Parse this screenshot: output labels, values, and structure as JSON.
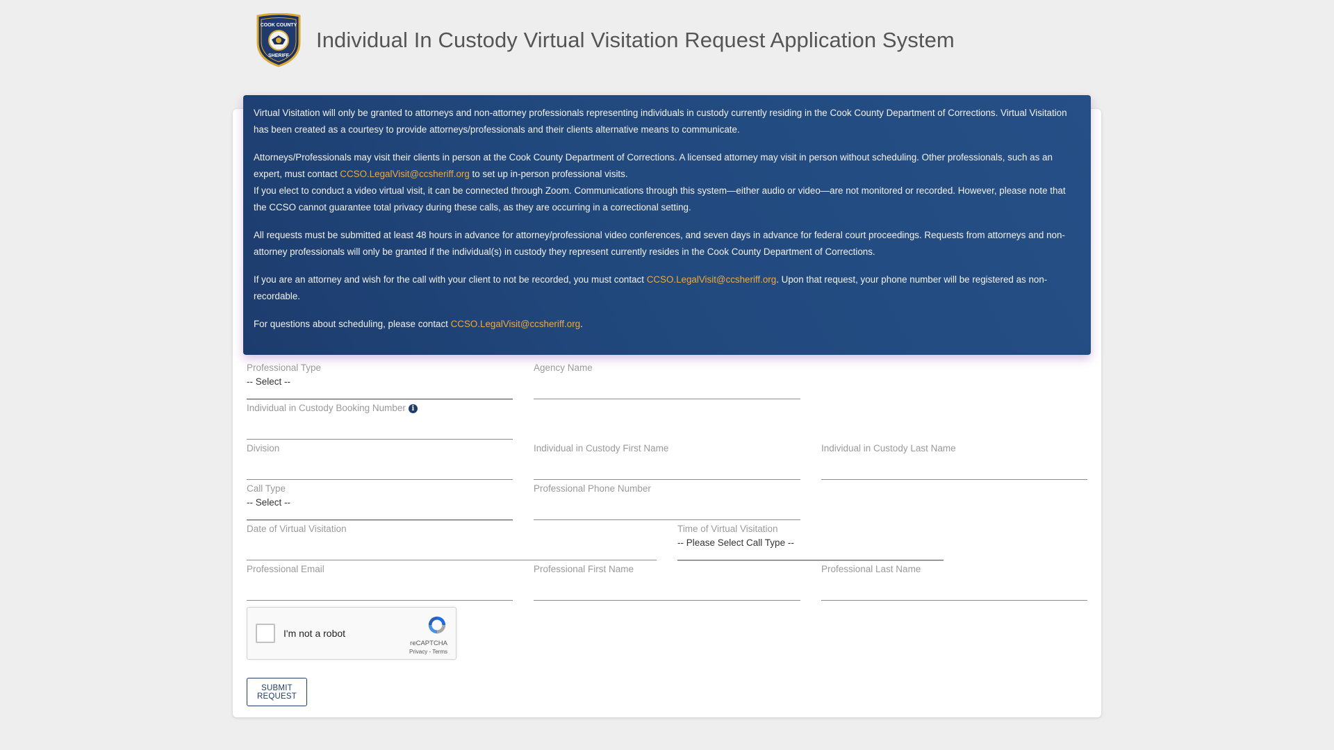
{
  "header": {
    "title": "Individual In Custody Virtual Visitation Request Application System",
    "logo_text": [
      "COOK COUNTY",
      "SHERIFF"
    ]
  },
  "notice": {
    "p1": "Virtual Visitation will only be granted to attorneys and non-attorney professionals representing individuals in custody currently residing in the Cook County Department of Corrections. Virtual Visitation has been created as a courtesy to provide attorneys/professionals and their clients alternative means to communicate.",
    "p2a": "Attorneys/Professionals may visit their clients in person at the Cook County Department of Corrections. A licensed attorney may visit in person without scheduling. Other professionals, such as an expert, must contact ",
    "p2_link": "CCSO.LegalVisit@ccsheriff.org",
    "p2b": " to set up in-person professional visits.",
    "p3": "If you elect to conduct a video virtual visit, it can be connected through Zoom. Communications through this system—either audio or video—are not monitored or recorded. However, please note that the CCSO cannot guarantee total privacy during these calls, as they are occurring in a correctional setting.",
    "p4": "All requests must be submitted at least 48 hours in advance for attorney/professional video conferences, and seven days in advance for federal court proceedings. Requests from attorneys and non-attorney professionals will only be granted if the individual(s) in custody they represent currently resides in the Cook County Department of Corrections.",
    "p5a": "If you are an attorney and wish for the call with your client to not be recorded, you must contact ",
    "p5_link": "CCSO.LegalVisit@ccsheriff.org",
    "p5b": ". Upon that request, your phone number will be registered as non-recordable.",
    "p6a": "For questions about scheduling, please contact ",
    "p6_link": "CCSO.LegalVisit@ccsheriff.org",
    "p6b": "."
  },
  "form": {
    "professional_type": {
      "label": "Professional Type",
      "value": "-- Select --"
    },
    "agency_name": {
      "label": "Agency Name",
      "value": ""
    },
    "booking_number": {
      "label": "Individual in Custody Booking Number",
      "value": ""
    },
    "division": {
      "label": "Division",
      "value": ""
    },
    "custody_first_name": {
      "label": "Individual in Custody First Name",
      "value": ""
    },
    "custody_last_name": {
      "label": "Individual in Custody Last Name",
      "value": ""
    },
    "call_type": {
      "label": "Call Type",
      "value": "-- Select --"
    },
    "phone_number": {
      "label": "Professional Phone Number",
      "value": ""
    },
    "visit_date": {
      "label": "Date of Virtual Visitation",
      "value": ""
    },
    "visit_time": {
      "label": "Time of Virtual Visitation",
      "value": "-- Please Select Call Type --"
    },
    "email": {
      "label": "Professional Email",
      "value": ""
    },
    "prof_first_name": {
      "label": "Professional First Name",
      "value": ""
    },
    "prof_last_name": {
      "label": "Professional Last Name",
      "value": ""
    }
  },
  "captcha": {
    "label": "I'm not a robot",
    "brand": "reCAPTCHA",
    "terms": "Privacy - Terms"
  },
  "submit_label": "SUBMIT REQUEST",
  "colors": {
    "notice_bg": "#21497e",
    "link": "#f0a93a",
    "primary": "#1e3d6c",
    "page_bg": "#eeeeee"
  }
}
